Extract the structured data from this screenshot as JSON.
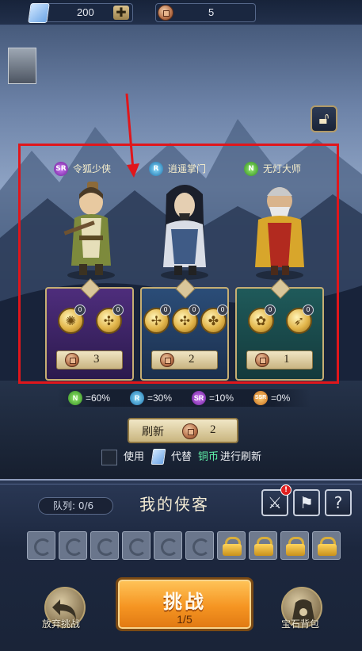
{
  "resources": {
    "gems": "200",
    "coins": "5"
  },
  "heroes": [
    {
      "rank": "SR",
      "name": "令狐少侠"
    },
    {
      "rank": "R",
      "name": "逍遥掌门"
    },
    {
      "rank": "N",
      "name": "无灯大师"
    }
  ],
  "cards": [
    {
      "price": "3",
      "skill_counts": [
        "0",
        "0"
      ]
    },
    {
      "price": "2",
      "skill_counts": [
        "0",
        "0",
        "0"
      ]
    },
    {
      "price": "1",
      "skill_counts": [
        "0",
        "0"
      ]
    }
  ],
  "odds": [
    {
      "rank": "N",
      "text": "=60%"
    },
    {
      "rank": "R",
      "text": "=30%"
    },
    {
      "rank": "SR",
      "text": "=10%"
    },
    {
      "rank": "SSR",
      "text": "=0%"
    }
  ],
  "refresh": {
    "label": "刷新",
    "cost": "2"
  },
  "use_gems": {
    "t1": "使用",
    "t2": "代替",
    "t3": "铜币",
    "t4": "进行刷新"
  },
  "team": {
    "label": "队列:",
    "count": "0/6",
    "title": "我的侠客",
    "alert": "!"
  },
  "bottom": {
    "abandon": "放弃挑战",
    "challenge": "挑战",
    "challenge_count": "1/5",
    "gem_bag": "宝石背包"
  },
  "colors": {
    "accent_red": "#e0161b",
    "challenge_orange": "#f59522"
  }
}
